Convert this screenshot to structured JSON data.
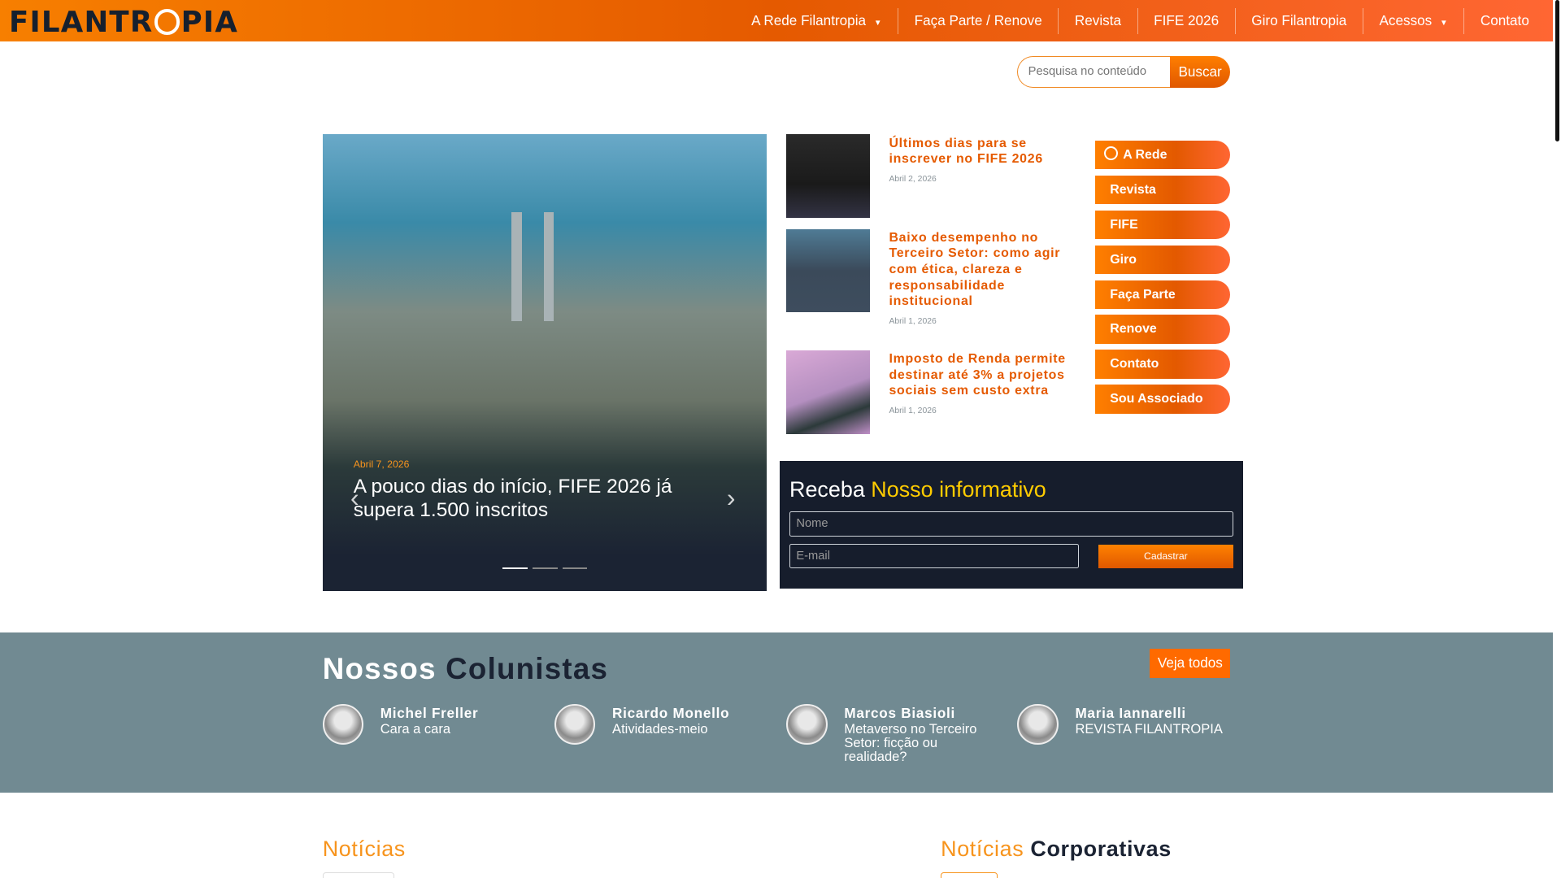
{
  "header": {
    "logo": "FILANTROPIA",
    "nav": [
      {
        "label": "A Rede Filantropia",
        "dropdown": true
      },
      {
        "label": "Faça Parte / Renove"
      },
      {
        "label": "Revista"
      },
      {
        "label": "FIFE 2026"
      },
      {
        "label": "Giro Filantropia"
      },
      {
        "label": "Acessos",
        "dropdown": true
      },
      {
        "label": "Contato"
      }
    ]
  },
  "search": {
    "placeholder": "Pesquisa no conteúdo",
    "button": "Buscar"
  },
  "slider": {
    "date": "Abril 7, 2026",
    "title": "A pouco dias do início, FIFE 2026 já supera 1.500 inscritos",
    "slides": 3,
    "active": 1
  },
  "news": [
    {
      "title": "Últimos dias para se inscrever no FIFE 2026",
      "date": "Abril 2, 2026"
    },
    {
      "title": "Baixo desempenho no Terceiro Setor: como agir com ética, clareza e responsabilidade institucional",
      "date": "Abril 1, 2026"
    },
    {
      "title": "Imposto de Renda permite destinar até 3% a projetos sociais sem custo extra",
      "date": "Abril 1, 2026"
    }
  ],
  "side_menu": [
    "A Rede",
    "Revista",
    "FIFE",
    "Giro",
    "Faça Parte",
    "Renove",
    "Contato",
    "Sou Associado"
  ],
  "newsletter": {
    "title_a": "Receba",
    "title_b": "Nosso informativo",
    "name_placeholder": "Nome",
    "email_placeholder": "E-mail",
    "button": "Cadastrar"
  },
  "columnists": {
    "title_a": "Nossos",
    "title_b": "Colunistas",
    "see_all": "Veja todos",
    "items": [
      {
        "name": "Michel Freller",
        "column": "Cara a cara"
      },
      {
        "name": "Ricardo Monello",
        "column": "Atividades-meio"
      },
      {
        "name": "Marcos Biasioli",
        "column": "Metaverso no Terceiro Setor: ficção ou realidade?"
      },
      {
        "name": "Maria Iannarelli",
        "column": "REVISTA FILANTROPIA"
      }
    ]
  },
  "sections": {
    "news": "Notícias",
    "corp_a": "Notícias",
    "corp_b": "Corporativas"
  },
  "colors": {
    "brand": "#f77f00",
    "dark": "#161d2c",
    "columnists_bg": "#718a92"
  }
}
